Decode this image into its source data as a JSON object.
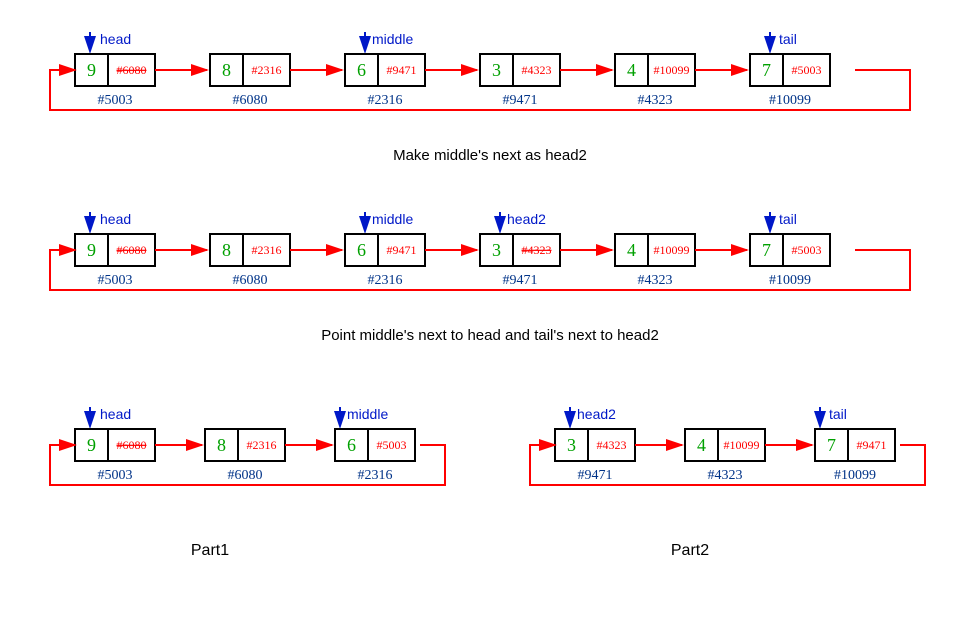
{
  "row1": {
    "nodes": [
      {
        "val": "9",
        "ptr": "#6080",
        "addr": "#5003",
        "strike": true
      },
      {
        "val": "8",
        "ptr": "#2316",
        "addr": "#6080",
        "strike": false
      },
      {
        "val": "6",
        "ptr": "#9471",
        "addr": "#2316",
        "strike": false
      },
      {
        "val": "3",
        "ptr": "#4323",
        "addr": "#9471",
        "strike": false
      },
      {
        "val": "4",
        "ptr": "#10099",
        "addr": "#4323",
        "strike": false
      },
      {
        "val": "7",
        "ptr": "#5003",
        "addr": "#10099",
        "strike": false
      }
    ],
    "labels": {
      "head": "head",
      "middle": "middle",
      "tail": "tail"
    },
    "caption": "Make middle's next as head2"
  },
  "row2": {
    "nodes": [
      {
        "val": "9",
        "ptr": "#6080",
        "addr": "#5003",
        "strike": true
      },
      {
        "val": "8",
        "ptr": "#2316",
        "addr": "#6080",
        "strike": false
      },
      {
        "val": "6",
        "ptr": "#9471",
        "addr": "#2316",
        "strike": false
      },
      {
        "val": "3",
        "ptr": "#4323",
        "addr": "#9471",
        "strike": true
      },
      {
        "val": "4",
        "ptr": "#10099",
        "addr": "#4323",
        "strike": false
      },
      {
        "val": "7",
        "ptr": "#5003",
        "addr": "#10099",
        "strike": false
      }
    ],
    "labels": {
      "head": "head",
      "middle": "middle",
      "head2": "head2",
      "tail": "tail"
    },
    "caption": "Point middle's next to head and tail's next to head2"
  },
  "row3": {
    "part1": {
      "nodes": [
        {
          "val": "9",
          "ptr": "#6080",
          "addr": "#5003",
          "strike": true
        },
        {
          "val": "8",
          "ptr": "#2316",
          "addr": "#6080",
          "strike": false
        },
        {
          "val": "6",
          "ptr": "#5003",
          "addr": "#2316",
          "strike": false
        }
      ],
      "labels": {
        "head": "head",
        "middle": "middle"
      },
      "title": "Part1"
    },
    "part2": {
      "nodes": [
        {
          "val": "3",
          "ptr": "#4323",
          "addr": "#9471",
          "strike": false
        },
        {
          "val": "4",
          "ptr": "#10099",
          "addr": "#4323",
          "strike": false
        },
        {
          "val": "7",
          "ptr": "#9471",
          "addr": "#10099",
          "strike": false
        }
      ],
      "labels": {
        "head2": "head2",
        "tail": "tail"
      },
      "title": "Part2"
    }
  }
}
